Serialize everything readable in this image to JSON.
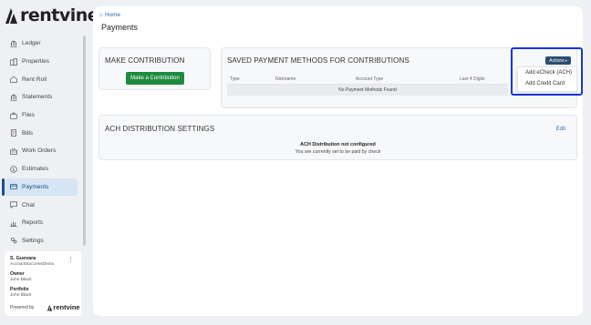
{
  "app": {
    "brand": "rentvine"
  },
  "sidebar": {
    "items": [
      {
        "label": "Ledger",
        "icon": "bank-icon"
      },
      {
        "label": "Properties",
        "icon": "buildings-icon"
      },
      {
        "label": "Rent Roll",
        "icon": "rent-roll-icon"
      },
      {
        "label": "Statements",
        "icon": "bank-icon"
      },
      {
        "label": "Files",
        "icon": "briefcase-icon"
      },
      {
        "label": "Bills",
        "icon": "receipt-icon"
      },
      {
        "label": "Work Orders",
        "icon": "toolbox-icon"
      },
      {
        "label": "Estimates",
        "icon": "dollar-circle-icon"
      },
      {
        "label": "Payments",
        "icon": "payment-icon",
        "active": true
      },
      {
        "label": "Chat",
        "icon": "chat-icon"
      },
      {
        "label": "Reports",
        "icon": "reports-icon"
      },
      {
        "label": "Settings",
        "icon": "settings-icon"
      }
    ]
  },
  "account": {
    "name": "S. Guevara",
    "account": "AccountSuccessDemo",
    "owner_label": "Owner",
    "owner": "John Black",
    "portfolio_label": "Portfolio",
    "portfolio": "John Black",
    "powered_by": "Powered by",
    "powered_brand": "rentvine"
  },
  "breadcrumb": {
    "home": "Home"
  },
  "page": {
    "title": "Payments"
  },
  "contribution": {
    "title": "MAKE CONTRIBUTION",
    "button": "Make a Contribution"
  },
  "saved_methods": {
    "title": "SAVED PAYMENT METHODS FOR CONTRIBUTIONS",
    "columns": [
      "Type",
      "Nickname",
      "Account Type",
      "Last 4 Digits"
    ],
    "empty": "No Payment Methods Found",
    "actions_label": "Actions",
    "actions_menu": [
      "Add eCheck (ACH)",
      "Add Credit Card"
    ]
  },
  "ach": {
    "title": "ACH DISTRIBUTION SETTINGS",
    "edit": "Edit",
    "status": "ACH Distribution not configured",
    "sub": "You are currently set to be paid by check"
  },
  "colors": {
    "accent": "#2a6fb5",
    "primary_green": "#1e8a3e",
    "actions_button": "#2b4d70",
    "highlight": "#1a34d6"
  }
}
